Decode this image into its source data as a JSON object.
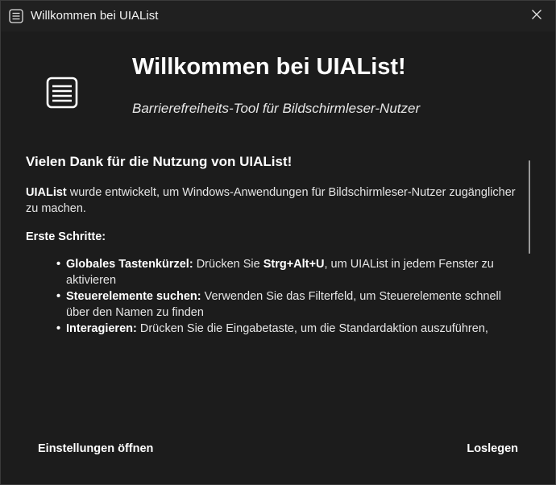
{
  "window": {
    "title": "Willkommen bei UIAList",
    "app_icon": "list-icon",
    "close_icon": "close-icon"
  },
  "hero": {
    "icon": "list-icon",
    "title": "Willkommen bei UIAList!",
    "subtitle": "Barrierefreiheits-Tool für Bildschirmleser-Nutzer"
  },
  "body": {
    "heading": "Vielen Dank für die Nutzung von UIAList!",
    "intro_bold": "UIAList",
    "intro_rest": " wurde entwickelt, um Windows-Anwendungen für Bildschirmleser-Nutzer zugänglicher zu machen.",
    "steps_heading": "Erste Schritte:",
    "steps": [
      {
        "bold": "Globales Tastenkürzel:",
        "text_before": " Drücken Sie ",
        "shortcut": "Strg+Alt+U",
        "text_after": ", um UIAList in jedem Fenster zu aktivieren"
      },
      {
        "bold": "Steuerelemente suchen:",
        "text": " Verwenden Sie das Filterfeld, um Steuerelemente schnell über den Namen zu finden"
      },
      {
        "bold": "Interagieren:",
        "text": " Drücken Sie die Eingabetaste, um die Standardaktion auszuführen,"
      }
    ]
  },
  "footer": {
    "settings_label": "Einstellungen öffnen",
    "start_label": "Loslegen"
  },
  "colors": {
    "background": "#1c1c1c",
    "titlebar": "#202020",
    "text": "#ffffff"
  }
}
